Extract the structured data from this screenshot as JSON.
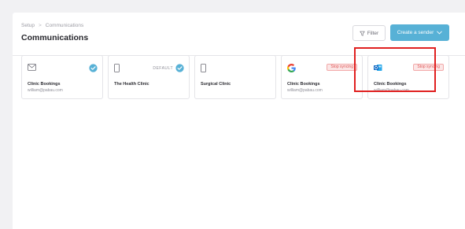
{
  "breadcrumb": {
    "parent": "Setup",
    "separator": ">",
    "current": "Communications"
  },
  "page_title": "Communications",
  "toolbar": {
    "filter_label": "Filter",
    "create_label": "Create a sender"
  },
  "colors": {
    "accent": "#57b1d6",
    "stop_badge": "#e05555",
    "highlight": "#e02020"
  },
  "cards": [
    {
      "icon": "envelope-icon",
      "title": "Clinic Bookings",
      "email": "william@pabau.com",
      "verified": true
    },
    {
      "icon": "mobile-icon",
      "title": "The Health Clinic",
      "default_label": "DEFAULT",
      "verified": true
    },
    {
      "icon": "mobile-icon",
      "title": "Surgical Clinic"
    },
    {
      "icon": "google-icon",
      "title": "Clinic Bookings",
      "email": "william@pabau.com",
      "badge": "Stop syncing"
    },
    {
      "icon": "outlook-icon",
      "title": "Clinic Bookings",
      "email": "william@pabau.com",
      "badge": "Stop syncing",
      "highlighted": true
    }
  ]
}
